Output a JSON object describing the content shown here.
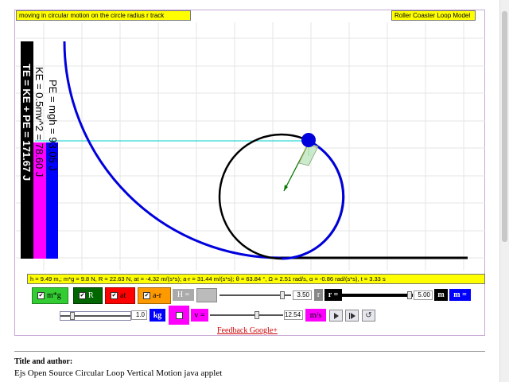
{
  "header": {
    "left_title": "moving in circular motion on the circle radius r track",
    "right_title": "Roller Coaster Loop Model"
  },
  "energy": {
    "pe": "PE = mgh = 93.05 J",
    "ke": "KE = 0.5mv^2 = 78.60 J",
    "te": "TE = KE + PE = 171.67 J"
  },
  "status_text": "h = 9.49 m,; m*g = 9.8 N, R = 22.63 N, at = -4.32 m/(s*s); a-r = 31.44 m/(s*s); θ = 63.84 °, Ω = 2.51 rad/s, α = -0.86 rad/(s*s), t = 3.33 s",
  "checkboxes": {
    "mg": {
      "label": "m*g",
      "checked": true,
      "color": "#33cc33"
    },
    "r": {
      "label": "R",
      "checked": true,
      "color": "#006600"
    },
    "at": {
      "label": "at",
      "checked": true,
      "color": "#ff0000"
    },
    "ar": {
      "label": "a-r",
      "checked": true,
      "color": "#ff9900"
    }
  },
  "controls": {
    "h_label": "H =",
    "h_value": "3.50",
    "r_small_label": "r",
    "r_label": "r =",
    "r_value": "5.00",
    "m_unit": "m",
    "m_label": "m =",
    "mass_value": "1.0",
    "mass_unit": "kg",
    "v_label": "v =",
    "v_value": "12.54",
    "v_unit": "m/s",
    "h_level": 0.15,
    "r_level": 0.98,
    "mass_level": 0.15,
    "v_level": 0.55,
    "play_icon": "play-icon",
    "step_icon": "step-icon",
    "reset_icon": "reset-icon"
  },
  "feedback_link": "Feedback Google+",
  "meta": {
    "title": "Title and author:",
    "text": "Ejs Open Source Circular Loop Vertical Motion java applet"
  },
  "colors": {
    "track": "#0000dd",
    "loop": "#000000",
    "ke_bar": "#ff00ff",
    "pe_bar": "#0000ff",
    "te_bar": "#000000",
    "status_bg": "#ffff00"
  }
}
